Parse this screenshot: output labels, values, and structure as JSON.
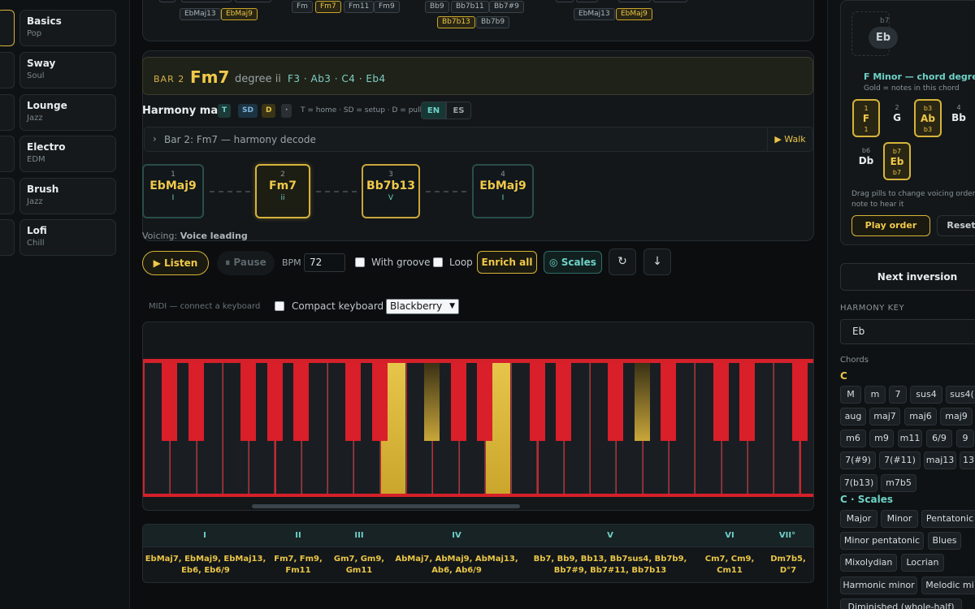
{
  "styles": [
    {
      "name": "Basics",
      "genre": "Pop"
    },
    {
      "name": "Sway",
      "genre": "Soul"
    },
    {
      "name": "Lounge",
      "genre": "Jazz"
    },
    {
      "name": "Electro",
      "genre": "EDM"
    },
    {
      "name": "Brush",
      "genre": "Jazz"
    },
    {
      "name": "Lofi",
      "genre": "Chill"
    }
  ],
  "top_chips": [
    "EbMaj13",
    "EbMaj9",
    "Fm",
    "Fm7",
    "Fm11",
    "Fm9",
    "Bb9",
    "Bb7b11",
    "Bb7#9",
    "Bb7b13",
    "Bb7b9",
    "EbMaj13",
    "EbMaj9"
  ],
  "bar": {
    "label": "BAR 2",
    "chord": "Fm7",
    "degree": "degree ii",
    "notes": "F3 · Ab3 · C4 · Eb4"
  },
  "harmony_map": {
    "title": "Harmony map",
    "tags": [
      "T",
      "SD",
      "D",
      "·"
    ],
    "legend": "T = home · SD = setup · D = pull",
    "lang_en": "EN",
    "lang_es": "ES",
    "decode_title": "Bar 2: Fm7 — harmony decode",
    "walk": "▶ Walk",
    "nodes": [
      {
        "num": "1",
        "chord": "EbMaj9",
        "roman": "I"
      },
      {
        "num": "2",
        "chord": "Fm7",
        "roman": "ii"
      },
      {
        "num": "3",
        "chord": "Bb7b13",
        "roman": "V"
      },
      {
        "num": "4",
        "chord": "EbMaj9",
        "roman": "I"
      }
    ],
    "voicing_label": "Voicing:",
    "voicing_value": "Voice leading"
  },
  "transport": {
    "listen": "▶ Listen",
    "pause": "⏸ Pause",
    "bpm_label": "BPM",
    "bpm_value": "72",
    "with_groove": "With groove",
    "loop": "Loop",
    "enrich": "Enrich all",
    "scales": "◎ Scales",
    "icon1": "↻",
    "icon2": "↓"
  },
  "midi": {
    "label": "MIDI — connect a keyboard",
    "compact": "Compact keyboard",
    "instrument": "Blackberry"
  },
  "keyboard": {
    "highlighted_white_keys": [
      9,
      13
    ],
    "highlighted_black_keys": [
      7,
      13
    ]
  },
  "degree_table": {
    "headers": [
      "I",
      "II",
      "III",
      "IV",
      "V",
      "VI",
      "VII°"
    ],
    "cells": [
      [
        "EbMaj7, EbMaj9, EbMaj13,",
        "Eb6, Eb6/9"
      ],
      [
        "Fm7, Fm9,",
        "Fm11"
      ],
      [
        "Gm7, Gm9,",
        "Gm11"
      ],
      [
        "AbMaj7, AbMaj9, AbMaj13,",
        "Ab6, Ab6/9"
      ],
      [
        "Bb7, Bb9, Bb13, Bb7sus4, Bb7b9,",
        "Bb7#9, Bb7#11, Bb7b13"
      ],
      [
        "Cm7, Cm9,",
        "Cm11"
      ],
      [
        "Dm7b5,",
        "D°7"
      ]
    ]
  },
  "right": {
    "b7": "b7",
    "eb": "Eb",
    "title": "F Minor — chord degrees highl",
    "subtitle": "Gold = notes in this chord",
    "degrees": [
      {
        "n": "1",
        "l": "F",
        "d": "1",
        "gold": true
      },
      {
        "n": "2",
        "l": "G",
        "d": "",
        "gold": false
      },
      {
        "n": "b3",
        "l": "Ab",
        "d": "b3",
        "gold": true
      },
      {
        "n": "4",
        "l": "Bb",
        "d": "",
        "gold": false
      },
      {
        "n": "b6",
        "l": "Db",
        "d": "",
        "gold": false
      },
      {
        "n": "b7",
        "l": "Eb",
        "d": "b7",
        "gold": true
      }
    ],
    "hint": "Drag pills to change voicing order note to hear it",
    "play_order": "Play order",
    "reset": "Reset",
    "next_inversion": "Next inversion",
    "harmony_key_label": "HARMONY KEY",
    "harmony_key_value": "Eb",
    "chords_label": "Chords",
    "root": "C",
    "qualities": [
      "M",
      "m",
      "7",
      "sus4",
      "sus4(",
      "aug",
      "maj7",
      "maj6",
      "maj9",
      "m6",
      "m9",
      "m11",
      "6/9",
      "9",
      "7(#9)",
      "7(#11)",
      "maj13",
      "13",
      "7(b13)",
      "m7b5"
    ],
    "scales_head": "C · Scales",
    "scales": [
      "Major",
      "Minor",
      "Pentatonic",
      "Minor pentatonic",
      "Blues",
      "Mixolydian",
      "Locrian",
      "Harmonic minor",
      "Melodic mi",
      "Diminished (whole-half)"
    ]
  }
}
